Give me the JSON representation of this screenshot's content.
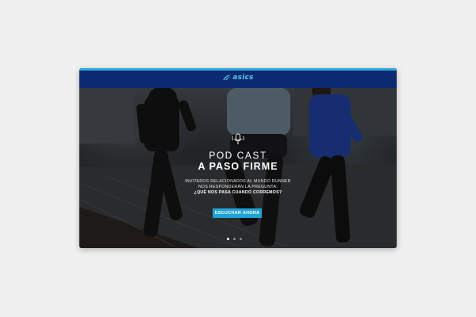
{
  "brand": {
    "logo_text": "asics",
    "accent_color": "#36a8df",
    "header_color": "#0b2a6f"
  },
  "hero": {
    "icon": "microphone-icon",
    "title_line1": "POD CAST",
    "title_line2": "A PASO FIRME",
    "description_line1": "INVITADOS RELACIONADOS AL MUNDO RUNNER",
    "description_line2": "NOS RESPONDERÁN LA PREGUNTA:",
    "description_line3": "¿QUÉ NOS PASA CUANDO CORREMOS?",
    "cta_label": "ESCUCHAR AHORA",
    "cta_color": "#1fa3d6"
  },
  "carousel": {
    "slide_count": 3,
    "active_index": 0
  }
}
